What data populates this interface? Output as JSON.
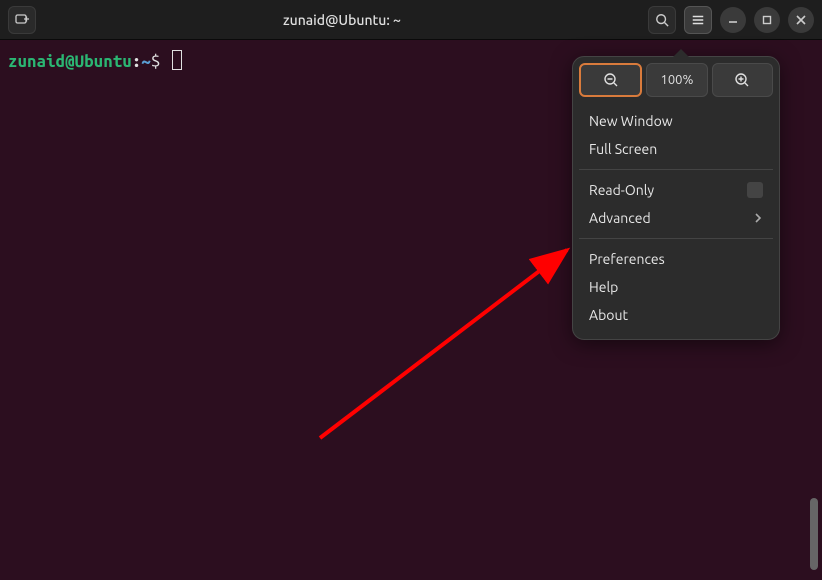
{
  "titlebar": {
    "title": "zunaid@Ubuntu: ~"
  },
  "prompt": {
    "user_host": "zunaid@Ubuntu",
    "colon": ":",
    "path": "~",
    "symbol": "$"
  },
  "menu": {
    "zoom_label": "100%",
    "new_window": "New Window",
    "full_screen": "Full Screen",
    "read_only": "Read-Only",
    "advanced": "Advanced",
    "preferences": "Preferences",
    "help": "Help",
    "about": "About"
  }
}
